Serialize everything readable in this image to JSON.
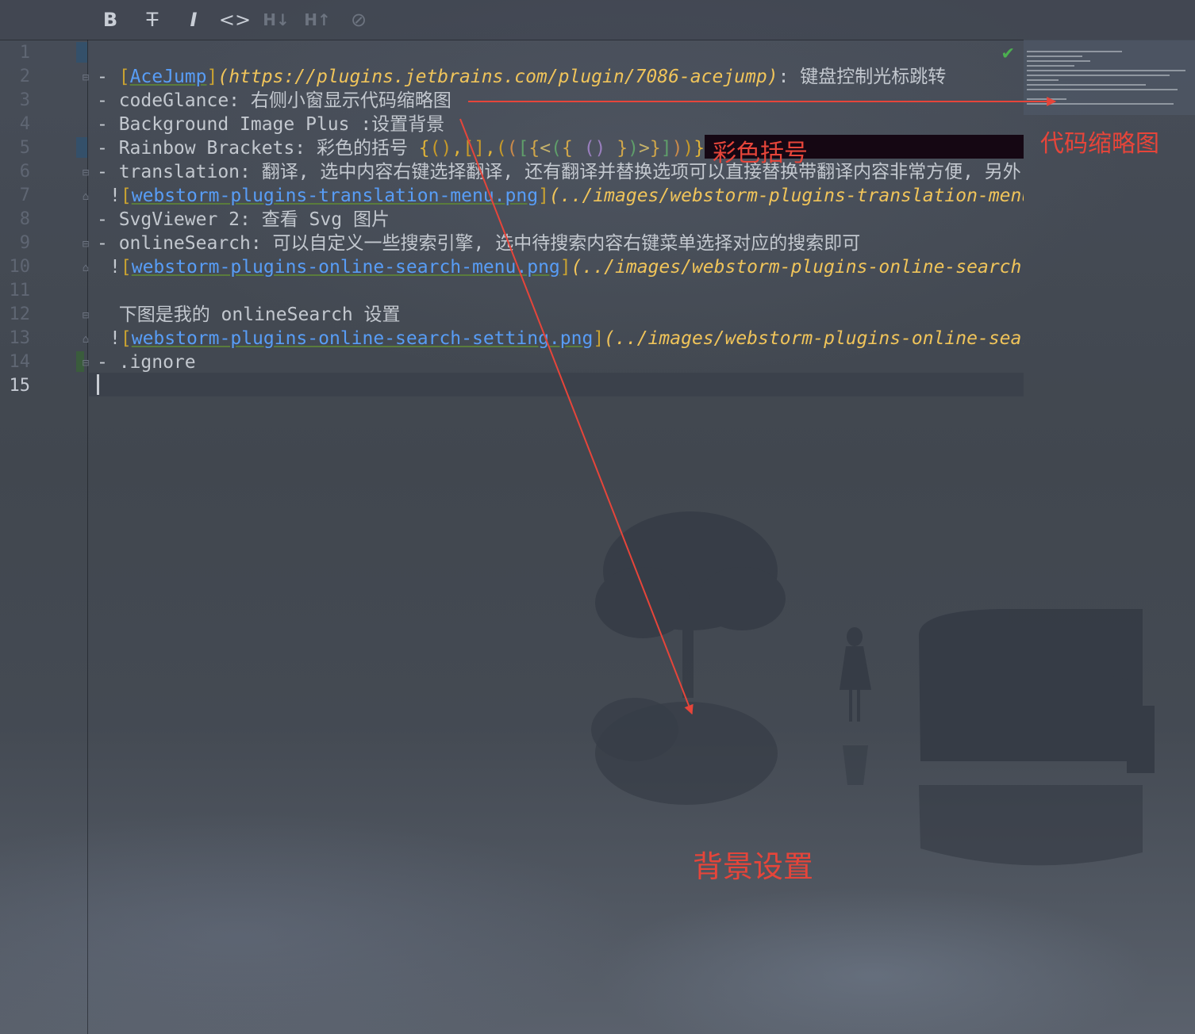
{
  "toolbar": {
    "bold_label": "B",
    "strike_label": "T",
    "italic_label": "I",
    "code_label": "<>",
    "h_down_label": "H↓",
    "h_up_label": "H↑",
    "link_label": "⊘"
  },
  "gutter": {
    "line_numbers": [
      "1",
      "2",
      "3",
      "4",
      "5",
      "6",
      "7",
      "8",
      "9",
      "10",
      "11",
      "12",
      "13",
      "14",
      "15"
    ],
    "current_line": "15"
  },
  "lines": {
    "l2": {
      "dash": "- ",
      "lbr": "[",
      "link_text": "AceJump",
      "rbr": "]",
      "url": "(https://plugins.jetbrains.com/plugin/7086-acejump)",
      "rest": ": 键盘控制光标跳转"
    },
    "l3": "- codeGlance: 右侧小窗显示代码缩略图",
    "l4": "- Background Image Plus :设置背景",
    "l5": {
      "prefix": "- Rainbow Brackets: 彩色的括号 ",
      "brackets": [
        "{",
        "(",
        ")",
        ",",
        "[",
        "]",
        ",",
        "(",
        "(",
        "[",
        "{",
        "<",
        "(",
        "{",
        " ",
        "(",
        ")",
        " ",
        "}",
        ")",
        ">",
        "}",
        "]",
        ")",
        ")",
        "}"
      ]
    },
    "l6": "- translation: 翻译, 选中内容右键选择翻译, 还有翻译并替换选项可以直接替换带翻译内容非常方便, 另外",
    "l7": {
      "bang": "!",
      "lbr": "[",
      "link_text": "webstorm-plugins-translation-menu.png",
      "rbr": "]",
      "url": "(../images/webstorm-plugins-translation-menu.png)"
    },
    "l8": "- SvgViewer 2: 查看 Svg 图片",
    "l9": "- onlineSearch: 可以自定义一些搜索引擎, 选中待搜索内容右键菜单选择对应的搜索即可",
    "l10": {
      "bang": "!",
      "lbr": "[",
      "link_text": "webstorm-plugins-online-search-menu.png",
      "rbr": "]",
      "url": "(../images/webstorm-plugins-online-search-menu.png)"
    },
    "l12": "  下图是我的 onlineSearch 设置",
    "l13": {
      "bang": "!",
      "lbr": "[",
      "link_text": "webstorm-plugins-online-search-setting.png",
      "rbr": "]",
      "url": "(../images/webstorm-plugins-online-search-setting.png)"
    },
    "l14": "- .ignore"
  },
  "annotations": {
    "rainbow": "彩色括号",
    "minimap": "代码缩略图",
    "background": "背景设置"
  },
  "colors": {
    "annotation": "#e6453a",
    "link": "#589df6",
    "url": "#f0c45a"
  }
}
